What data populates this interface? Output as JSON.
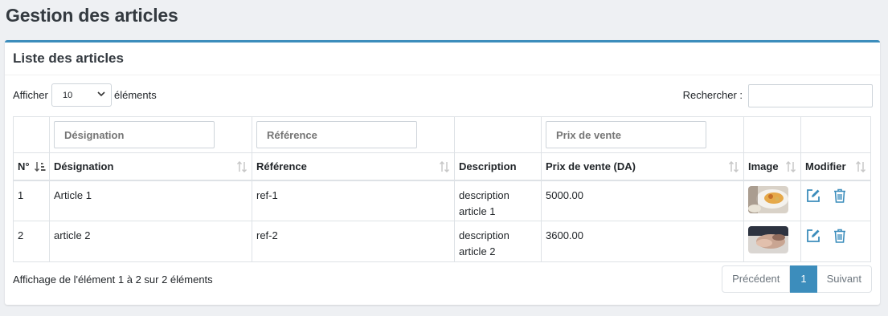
{
  "page": {
    "title": "Gestion des articles"
  },
  "card": {
    "title": "Liste des articles"
  },
  "toolbar": {
    "show_label": "Afficher",
    "show_value": "10",
    "entries_label": "éléments",
    "search_label": "Rechercher :"
  },
  "filters": {
    "designation_placeholder": "Désignation",
    "reference_placeholder": "Référence",
    "price_placeholder": "Prix de vente"
  },
  "columns": [
    {
      "label": "N°"
    },
    {
      "label": "Désignation"
    },
    {
      "label": "Référence"
    },
    {
      "label": "Description"
    },
    {
      "label": "Prix de vente (DA)"
    },
    {
      "label": "Image"
    },
    {
      "label": "Modifier"
    }
  ],
  "rows": [
    {
      "num": "1",
      "designation": "Article 1",
      "reference": "ref-1",
      "description_line1": "description",
      "description_line2": "article 1",
      "price": "5000.00"
    },
    {
      "num": "2",
      "designation": "article 2",
      "reference": "ref-2",
      "description_line1": "description",
      "description_line2": "article 2",
      "price": "3600.00"
    }
  ],
  "footer": {
    "info": "Affichage de l'élément 1 à 2 sur 2 éléments",
    "prev_label": "Précédent",
    "page_label": "1",
    "next_label": "Suivant"
  },
  "colors": {
    "accent": "#3c8dbc",
    "background": "#eef0f3"
  },
  "icons": [
    "chevron-down-icon",
    "sort-icon",
    "edit-icon",
    "trash-icon"
  ]
}
